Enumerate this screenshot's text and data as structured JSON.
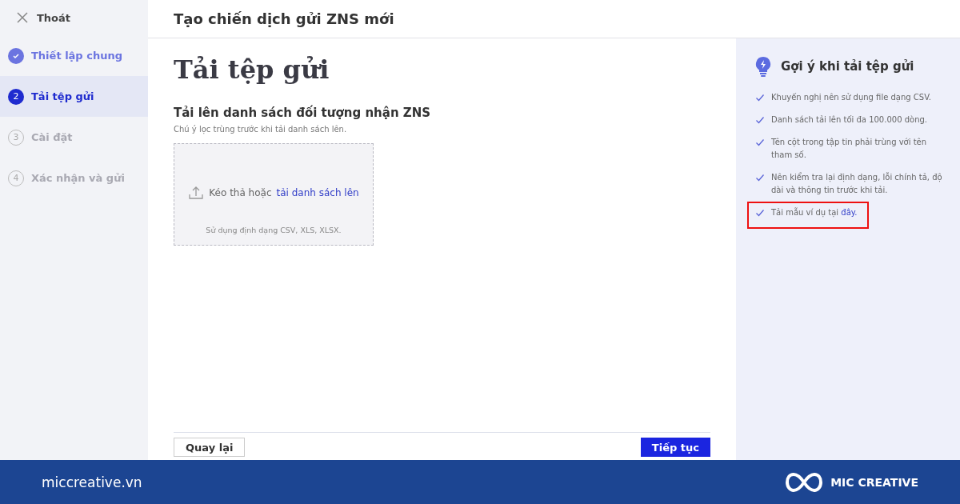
{
  "sidebar": {
    "exit": {
      "label": "Thoát"
    },
    "steps": [
      {
        "label": "Thiết lập chung",
        "completed": true,
        "selected": false
      },
      {
        "marker": "2",
        "label": "Tải tệp gửi",
        "completed": false,
        "selected": true
      },
      {
        "marker": "3",
        "label": "Cài đặt",
        "completed": false,
        "selected": false
      },
      {
        "marker": "4",
        "label": "Xác nhận và gửi",
        "completed": false,
        "selected": false
      }
    ]
  },
  "header": {
    "title": "Tạo chiến dịch gửi ZNS mới"
  },
  "main": {
    "title": "Tải tệp gửi",
    "section_title": "Tải lên danh sách đối tượng nhận ZNS",
    "note": "Chú ý lọc trùng trước khi tải danh sách lên.",
    "dropzone": {
      "text": "Kéo thả hoặc",
      "link": "tải danh sách lên",
      "formats": "Sử dụng định dạng CSV, XLS, XLSX."
    },
    "buttons": [
      {
        "label": "Quay lại",
        "kind": "secondary"
      },
      {
        "label": "Tiếp tục",
        "kind": "primary"
      }
    ]
  },
  "tips": {
    "title": "Gợi ý khi tải tệp gửi",
    "items": [
      {
        "text": "Khuyến nghị nên sử dụng file dạng CSV.",
        "highlighted": false
      },
      {
        "text": "Danh sách tải lên tối đa 100.000 dòng.",
        "highlighted": false
      },
      {
        "text": "Tên cột trong tập tin phải trùng với tên tham số.",
        "highlighted": false
      },
      {
        "text": "Nên kiểm tra lại định dạng, lỗi chính tả, độ dài và thông tin trước khi tải.",
        "highlighted": false
      },
      {
        "text": "Tải mẫu ví dụ tại",
        "link": "đây.",
        "highlighted": true
      }
    ]
  },
  "banner": {
    "site": "miccreative.vn",
    "brand": "MIC CREATIVE"
  }
}
